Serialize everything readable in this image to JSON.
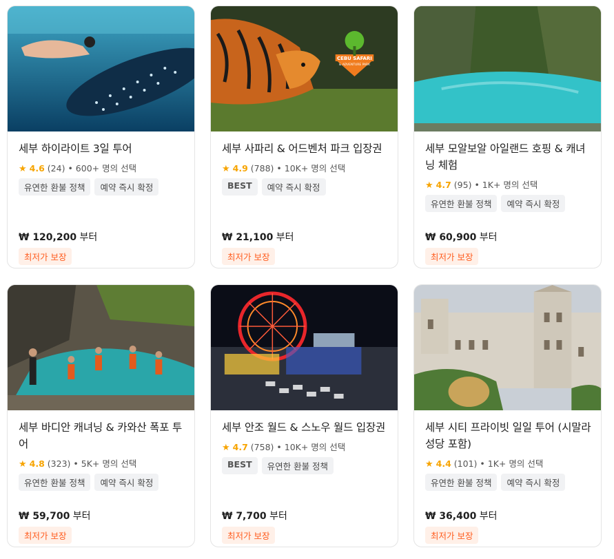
{
  "cards": [
    {
      "title": "세부 하이라이트 3일 투어",
      "rating": "4.6",
      "reviews": "(24)",
      "sep": "•",
      "picks": "600+ 명의 선택",
      "tags": [
        "유연한 환불 정책",
        "예약 즉시 확정"
      ],
      "price": "₩ 120,200",
      "price_suffix": "부터",
      "badge": "최저가 보장",
      "image": "whale-shark-snorkel"
    },
    {
      "title": "세부 사파리 & 어드벤처 파크 입장권",
      "rating": "4.9",
      "reviews": "(788)",
      "sep": "•",
      "picks": "10K+ 명의 선택",
      "tags": [
        "BEST",
        "예약 즉시 확정"
      ],
      "price": "₩ 21,100",
      "price_suffix": "부터",
      "badge": "최저가 보장",
      "image": "tiger-safari",
      "logo_text": "CEBU SAFARI",
      "logo_sub": "& ADVENTURE PARK"
    },
    {
      "title": "세부 모알보알 아일랜드 호핑 & 캐녀닝 체험",
      "rating": "4.7",
      "reviews": "(95)",
      "sep": "•",
      "picks": "1K+ 명의 선택",
      "tags": [
        "유연한 환불 정책",
        "예약 즉시 확정"
      ],
      "price": "₩ 60,900",
      "price_suffix": "부터",
      "badge": "최저가 보장",
      "image": "canyon-river"
    },
    {
      "title": "세부 바디안 캐녀닝 & 카와산 폭포 투어",
      "rating": "4.8",
      "reviews": "(323)",
      "sep": "•",
      "picks": "5K+ 명의 선택",
      "tags": [
        "유연한 환불 정책",
        "예약 즉시 확정"
      ],
      "price": "₩ 59,700",
      "price_suffix": "부터",
      "badge": "최저가 보장",
      "image": "canyoneering-jump"
    },
    {
      "title": "세부 안조 월드 & 스노우 월드 입장권",
      "rating": "4.7",
      "reviews": "(758)",
      "sep": "•",
      "picks": "10K+ 명의 선택",
      "tags": [
        "BEST",
        "유연한 환불 정책"
      ],
      "price": "₩ 7,700",
      "price_suffix": "부터",
      "badge": "최저가 보장",
      "image": "ferris-wheel-night"
    },
    {
      "title": "세부 시티 프라이빗 일일 투어 (시말라 성당 포함)",
      "rating": "4.4",
      "reviews": "(101)",
      "sep": "•",
      "picks": "1K+ 명의 선택",
      "tags": [
        "유연한 환불 정책",
        "예약 즉시 확정"
      ],
      "price": "₩ 36,400",
      "price_suffix": "부터",
      "badge": "최저가 보장",
      "image": "simala-church"
    }
  ],
  "colors": {
    "star": "#f7a400",
    "badge_bg": "#fff0e8",
    "badge_text": "#ff5d1f",
    "tag_bg": "#f1f2f4"
  }
}
